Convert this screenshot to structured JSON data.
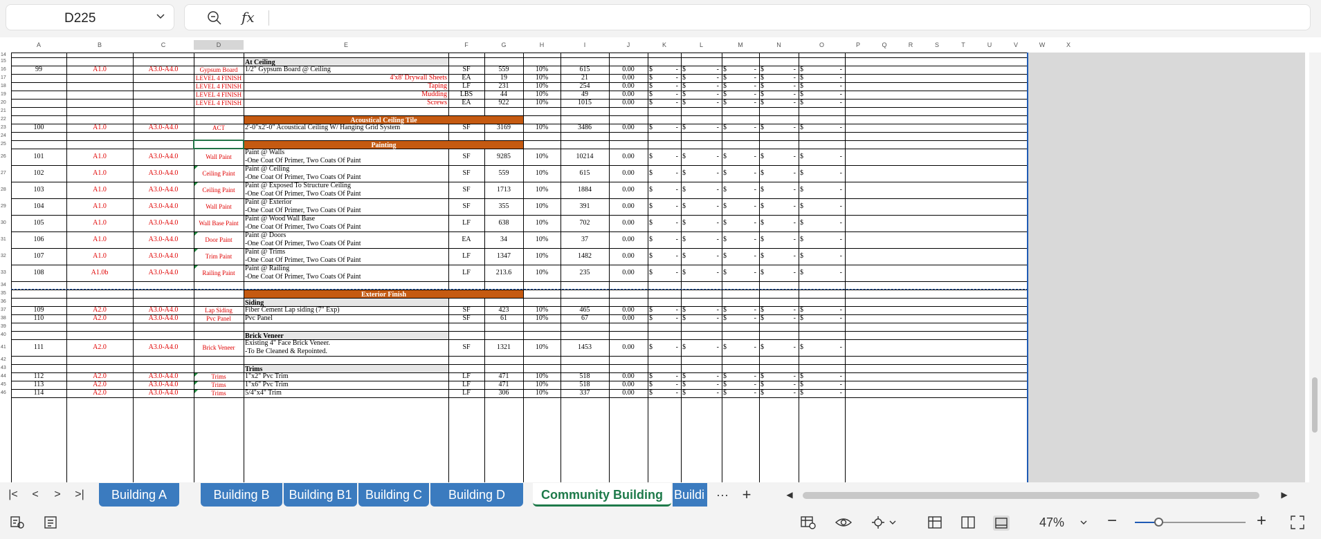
{
  "formula_bar": {
    "cell_ref": "D225",
    "formula": ""
  },
  "columns": [
    "A",
    "B",
    "C",
    "D",
    "E",
    "F",
    "G",
    "H",
    "I",
    "J",
    "K",
    "L",
    "M",
    "N",
    "O",
    "P",
    "Q",
    "R",
    "S",
    "T",
    "U",
    "V",
    "W",
    "X"
  ],
  "row_numbers": [
    "14",
    "15",
    "16",
    "17",
    "18",
    "19",
    "20",
    "21",
    "22",
    "23",
    "24",
    "25",
    "26",
    "27",
    "28",
    "29",
    "30",
    "31",
    "32",
    "33",
    "34",
    "35",
    "36",
    "37",
    "38",
    "39",
    "40",
    "41",
    "42",
    "43",
    "44",
    "45",
    "46"
  ],
  "sections": {
    "at_ceiling": "At Ceiling",
    "acoustical": "Acoustical Ceiling Tile",
    "painting": "Painting",
    "exterior_finish": "Exterior Finish",
    "siding": "Siding",
    "brick_veneer": "Brick Veneer",
    "trims": "Trims"
  },
  "currency_symbol": "$",
  "currency_dash": "-",
  "items": [
    {
      "a": "99",
      "b": "A1.0",
      "c": "A3.0-A4.0",
      "d": "Gypsum Board",
      "e1": "1/2\" Gypsum Board @ Ceiling",
      "e2": "",
      "f": "SF",
      "g": "559",
      "h": "10%",
      "i": "615",
      "j": "0.00"
    },
    {
      "a": "",
      "b": "",
      "c": "",
      "d": "LEVEL 4 FINISH",
      "e1": "4'x8' Drywall Sheets",
      "e2": "",
      "f": "EA",
      "g": "19",
      "h": "10%",
      "i": "21",
      "j": "0.00"
    },
    {
      "a": "",
      "b": "",
      "c": "",
      "d": "LEVEL 4 FINISH",
      "e1": "Taping",
      "e2": "",
      "f": "LF",
      "g": "231",
      "h": "10%",
      "i": "254",
      "j": "0.00"
    },
    {
      "a": "",
      "b": "",
      "c": "",
      "d": "LEVEL 4 FINISH",
      "e1": "Mudding",
      "e2": "",
      "f": "LBS",
      "g": "44",
      "h": "10%",
      "i": "49",
      "j": "0.00"
    },
    {
      "a": "",
      "b": "",
      "c": "",
      "d": "LEVEL 4 FINISH",
      "e1": "Screws",
      "e2": "",
      "f": "EA",
      "g": "922",
      "h": "10%",
      "i": "1015",
      "j": "0.00"
    },
    {
      "a": "100",
      "b": "A1.0",
      "c": "A3.0-A4.0",
      "d": "ACT",
      "e1": "2'-0\"x2'-0\" Acoustical Ceiling W/ Hanging Grid System",
      "e2": "",
      "f": "SF",
      "g": "3169",
      "h": "10%",
      "i": "3486",
      "j": "0.00"
    },
    {
      "a": "101",
      "b": "A1.0",
      "c": "A3.0-A4.0",
      "d": "Wall Paint",
      "e1": "Paint @ Walls",
      "e2": "-One Coat Of Primer, Two Coats Of Paint",
      "f": "SF",
      "g": "9285",
      "h": "10%",
      "i": "10214",
      "j": "0.00"
    },
    {
      "a": "102",
      "b": "A1.0",
      "c": "A3.0-A4.0",
      "d": "Ceiling Paint",
      "e1": "Paint @ Ceiling",
      "e2": "-One Coat Of Primer, Two Coats Of Paint",
      "f": "SF",
      "g": "559",
      "h": "10%",
      "i": "615",
      "j": "0.00"
    },
    {
      "a": "103",
      "b": "A1.0",
      "c": "A3.0-A4.0",
      "d": "Ceiling Paint",
      "e1": "Paint @ Exposed To Structure Ceiling",
      "e2": "-One Coat Of Primer, Two Coats Of Paint",
      "f": "SF",
      "g": "1713",
      "h": "10%",
      "i": "1884",
      "j": "0.00"
    },
    {
      "a": "104",
      "b": "A1.0",
      "c": "A3.0-A4.0",
      "d": "Wall Paint",
      "e1": "Paint @ Exterior",
      "e2": "-One Coat Of Primer, Two Coats Of Paint",
      "f": "SF",
      "g": "355",
      "h": "10%",
      "i": "391",
      "j": "0.00"
    },
    {
      "a": "105",
      "b": "A1.0",
      "c": "A3.0-A4.0",
      "d": "Wall Base Paint",
      "e1": "Paint @ Wood Wall Base",
      "e2": "-One Coat Of Primer, Two Coats Of Paint",
      "f": "LF",
      "g": "638",
      "h": "10%",
      "i": "702",
      "j": "0.00"
    },
    {
      "a": "106",
      "b": "A1.0",
      "c": "A3.0-A4.0",
      "d": "Door Paint",
      "e1": "Paint @ Doors",
      "e2": "-One Coat Of Primer, Two Coats Of Paint",
      "f": "EA",
      "g": "34",
      "h": "10%",
      "i": "37",
      "j": "0.00"
    },
    {
      "a": "107",
      "b": "A1.0",
      "c": "A3.0-A4.0",
      "d": "Trim Paint",
      "e1": "Paint @ Trims",
      "e2": "-One Coat Of Primer, Two Coats Of Paint",
      "f": "LF",
      "g": "1347",
      "h": "10%",
      "i": "1482",
      "j": "0.00"
    },
    {
      "a": "108",
      "b": "A1.0b",
      "c": "A3.0-A4.0",
      "d": "Railing Paint",
      "e1": "Paint @ Railing",
      "e2": "-One Coat Of Primer, Two Coats Of Paint",
      "f": "LF",
      "g": "213.6",
      "h": "10%",
      "i": "235",
      "j": "0.00"
    },
    {
      "a": "109",
      "b": "A2.0",
      "c": "A3.0-A4.0",
      "d": "Lap Siding",
      "e1": "Fiber Cement Lap siding (7\" Exp)",
      "e2": "",
      "f": "SF",
      "g": "423",
      "h": "10%",
      "i": "465",
      "j": "0.00"
    },
    {
      "a": "110",
      "b": "A2.0",
      "c": "A3.0-A4.0",
      "d": "Pvc Panel",
      "e1": "Pvc Panel",
      "e2": "",
      "f": "SF",
      "g": "61",
      "h": "10%",
      "i": "67",
      "j": "0.00"
    },
    {
      "a": "111",
      "b": "A2.0",
      "c": "A3.0-A4.0",
      "d": "Brick Veneer",
      "e1": "Existing 4\" Face Brick Veneer.",
      "e2": "-To Be Cleaned & Repointed.",
      "f": "SF",
      "g": "1321",
      "h": "10%",
      "i": "1453",
      "j": "0.00"
    },
    {
      "a": "112",
      "b": "A2.0",
      "c": "A3.0-A4.0",
      "d": "Trims",
      "e1": "1\"x2\" Pvc Trim",
      "e2": "",
      "f": "LF",
      "g": "471",
      "h": "10%",
      "i": "518",
      "j": "0.00"
    },
    {
      "a": "113",
      "b": "A2.0",
      "c": "A3.0-A4.0",
      "d": "Trims",
      "e1": "1\"x6\" Pvc Trim",
      "e2": "",
      "f": "LF",
      "g": "471",
      "h": "10%",
      "i": "518",
      "j": "0.00"
    },
    {
      "a": "114",
      "b": "A2.0",
      "c": "A3.0-A4.0",
      "d": "Trims",
      "e1": "5/4\"x4\" Trim",
      "e2": "",
      "f": "LF",
      "g": "306",
      "h": "10%",
      "i": "337",
      "j": "0.00"
    }
  ],
  "tabs": [
    {
      "label": "Building A",
      "active": false
    },
    {
      "label": "Building B",
      "active": false
    },
    {
      "label": "Building B1",
      "active": false
    },
    {
      "label": "Building C",
      "active": false
    },
    {
      "label": "Building D",
      "active": false
    },
    {
      "label": "Community Building",
      "active": true
    },
    {
      "label": "Buildi",
      "active": false
    }
  ],
  "status": {
    "zoom": "47%"
  },
  "colors": {
    "section_orange": "#c55a11",
    "tab_blue": "#3b7bbf",
    "active_tab_green": "#1e7a4a",
    "red_text": "#e00000"
  }
}
